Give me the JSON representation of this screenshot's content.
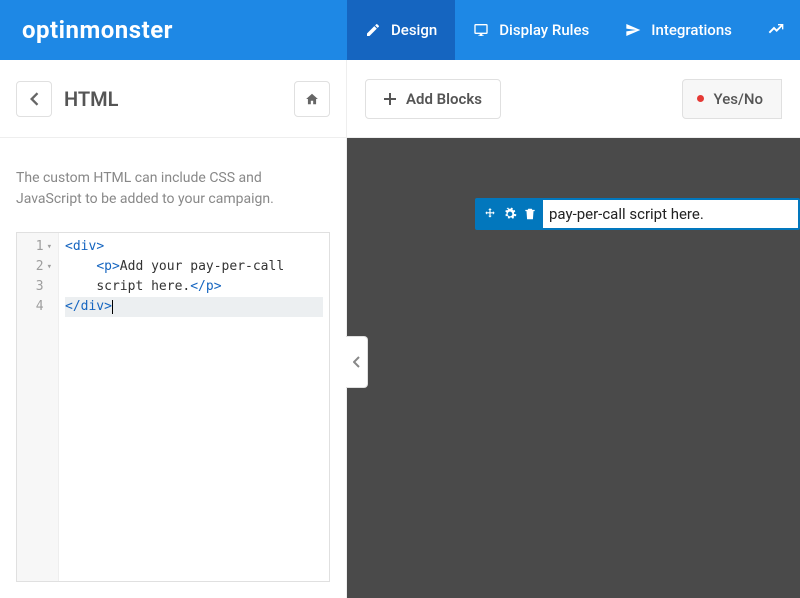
{
  "brand": "optinmonster",
  "nav": {
    "design": "Design",
    "display_rules": "Display Rules",
    "integrations": "Integrations"
  },
  "subbar": {
    "title": "HTML",
    "add_blocks": "Add Blocks",
    "yesno": "Yes/No"
  },
  "hint": "The custom HTML can include CSS and JavaScript to be added to your campaign.",
  "code": {
    "l1": "1",
    "l2": "2",
    "l3": "3",
    "l4": "4",
    "line1_open": "<",
    "line1_tag": "div",
    "line1_close": ">",
    "line2_indent": "    ",
    "line2_open": "<",
    "line2_tag": "p",
    "line2_close": ">",
    "line2_text": "Add your pay-per-call ",
    "line3_indent": "    ",
    "line3_text": "script here.",
    "line3_open": "</",
    "line3_tag": "p",
    "line3_close": ">",
    "line4_open": "</",
    "line4_tag": "div",
    "line4_close": ">"
  },
  "preview_text": "pay-per-call script here."
}
